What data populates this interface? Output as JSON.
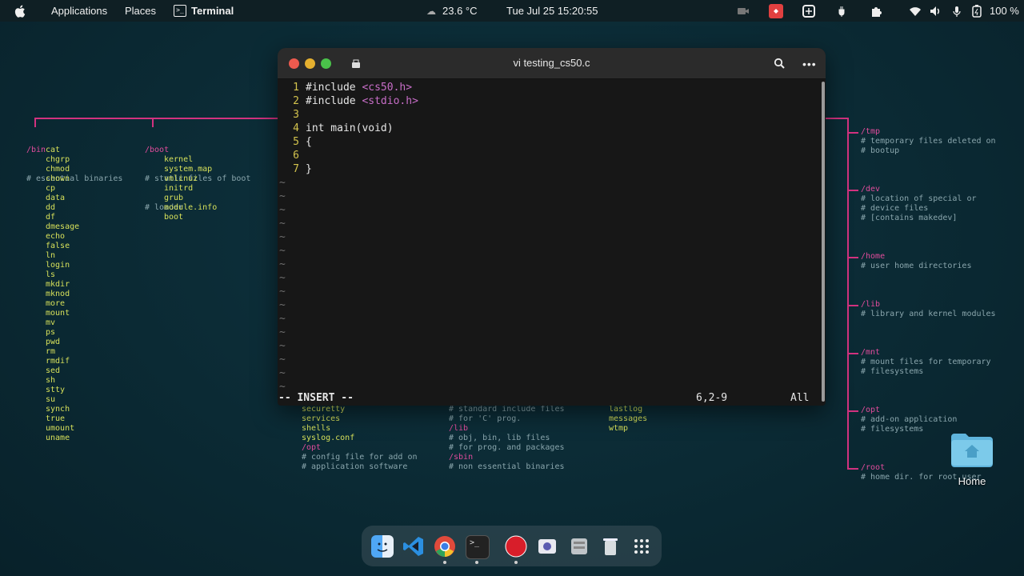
{
  "topbar": {
    "applications": "Applications",
    "places": "Places",
    "active_app": "Terminal",
    "weather": "23.6 °C",
    "datetime": "Tue Jul 25  15:20:55",
    "battery": "100 %"
  },
  "terminal": {
    "title": "vi testing_cs50.c",
    "code_lines": [
      {
        "num": "1",
        "pre": "#include ",
        "inc": "<cs50.h>",
        "post": ""
      },
      {
        "num": "2",
        "pre": "#include ",
        "inc": "<stdio.h>",
        "post": ""
      },
      {
        "num": "3",
        "pre": "",
        "inc": "",
        "post": ""
      },
      {
        "num": "4",
        "pre": "int main(void)",
        "inc": "",
        "post": ""
      },
      {
        "num": "5",
        "pre": "{",
        "inc": "",
        "post": ""
      },
      {
        "num": "6",
        "pre": "",
        "inc": "",
        "post": ""
      },
      {
        "num": "7",
        "pre": "}",
        "inc": "",
        "post": ""
      }
    ],
    "tilde": "~",
    "mode": "-- INSERT --",
    "cursor_pos": "6,2-9",
    "scroll_pos": "All"
  },
  "wallpaper": {
    "bin": {
      "dir": "/bin",
      "comment": "# essential binaries",
      "items": [
        "cat",
        "chgrp",
        "chmod",
        "chown",
        "cp",
        "data",
        "dd",
        "df",
        "dmesage",
        "echo",
        "false",
        "ln",
        "login",
        "ls",
        "mkdir",
        "mknod",
        "more",
        "mount",
        "mv",
        "ps",
        "pwd",
        "rm",
        "rmdif",
        "sed",
        "sh",
        "stty",
        "su",
        "synch",
        "true",
        "umount",
        "uname"
      ]
    },
    "boot": {
      "dir": "/boot",
      "comment": "# static files of boot",
      "comment2": "# loader",
      "items": [
        "kernel",
        "system.map",
        "vmlinuz",
        "initrd",
        "grub",
        "module.info",
        "boot"
      ]
    },
    "right": [
      {
        "dir": "/tmp",
        "lines": [
          "# temporary files deleted on",
          "# bootup"
        ]
      },
      {
        "dir": "/dev",
        "lines": [
          "# location of special or",
          "# device files",
          "# [contains makedev]"
        ]
      },
      {
        "dir": "/home",
        "lines": [
          "# user home directories"
        ]
      },
      {
        "dir": "/lib",
        "lines": [
          "# library and kernel modules"
        ]
      },
      {
        "dir": "/mnt",
        "lines": [
          "# mount files for temporary",
          "# filesystems"
        ]
      },
      {
        "dir": "/opt",
        "lines": [
          "# add-on application",
          "# filesystems"
        ]
      },
      {
        "dir": "/root",
        "lines": [
          "# home dir. for root user"
        ]
      }
    ],
    "bottom_col1": [
      "securetty",
      "services",
      "shells",
      "syslog.conf"
    ],
    "bottom_col1_dir": "/opt",
    "bottom_col1_comments": [
      "# config file for add on",
      "# application software"
    ],
    "bottom_col2": [
      {
        "t": "# standard include files",
        "c": "cmt"
      },
      {
        "t": "# for 'C' prog.",
        "c": "cmt"
      },
      {
        "t": "/lib",
        "c": "dir"
      },
      {
        "t": "# obj, bin, lib files",
        "c": "cmt"
      },
      {
        "t": "# for prog. and packages",
        "c": "cmt"
      },
      {
        "t": "/sbin",
        "c": "dir"
      },
      {
        "t": "# non essential binaries",
        "c": "cmt"
      }
    ],
    "bottom_col3": [
      "lastlog",
      "messages",
      "wtmp"
    ]
  },
  "desktop": {
    "home_label": "Home"
  },
  "dock": {
    "apps": [
      "finder-icon",
      "vscode-icon",
      "chrome-icon",
      "terminal-icon",
      "record-icon",
      "screenshot-icon",
      "files-icon",
      "trash-icon",
      "app-grid-icon"
    ]
  },
  "colors": {
    "accent_pink": "#d2327f",
    "vim_line_numbers": "#d3c34d",
    "include_magenta": "#c86ec8"
  }
}
